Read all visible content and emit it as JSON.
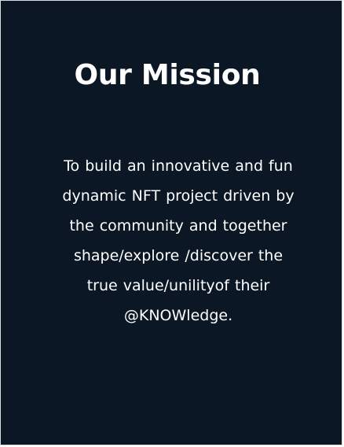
{
  "mission": {
    "title": "Our Mission",
    "lines": [
      "To build an innovative and fun",
      "dynamic NFT project driven by",
      "the community and together",
      "shape/explore /discover the",
      "true value/unilityof their",
      "@KNOWledge."
    ]
  },
  "colors": {
    "card_background": "#0b1724",
    "text": "#ffffff"
  }
}
